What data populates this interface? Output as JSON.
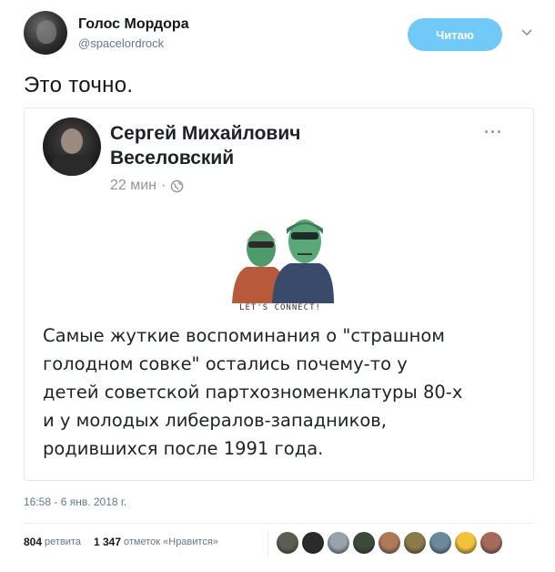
{
  "header": {
    "name": "Голос Мордора",
    "handle": "@spacelordrock",
    "follow_label": "Читаю"
  },
  "tweet_text": "Это точно.",
  "card": {
    "author_line1": "Сергей Михайлович",
    "author_line2": "Веселовский",
    "time": "22 мин",
    "separator": "·",
    "more": "···",
    "image_caption": "LET'S CONNECT!",
    "post_lines": [
      "Самые жуткие воспоминания о \"страшном",
      "голодном совке\" остались почему-то у",
      "детей советской партхозноменклатуры 80-х",
      "и у молодых либералов-западников,",
      "родившихся после 1991 года."
    ]
  },
  "timestamp": "16:58 - 6 янв. 2018 г.",
  "stats": {
    "retweets_count": "804",
    "retweets_label": "ретвита",
    "likes_count": "1 347",
    "likes_label": "отметок «Нравится»"
  },
  "likers": [
    {
      "color": "#5a5f55"
    },
    {
      "color": "#2b2b2b"
    },
    {
      "color": "#9aa3ab"
    },
    {
      "color": "#3d4a3a"
    },
    {
      "color": "#b07a5a"
    },
    {
      "color": "#8b7a4a"
    },
    {
      "color": "#6a8a9a"
    },
    {
      "color": "#f2c23a"
    },
    {
      "color": "#a66a5a"
    }
  ],
  "colors": {
    "follow_button": "#71c9f8",
    "secondary_text": "#657786",
    "fb_meta": "#90949c"
  }
}
